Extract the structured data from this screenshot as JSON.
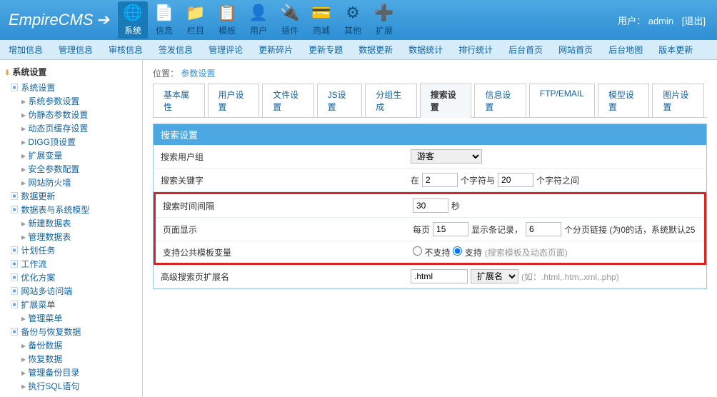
{
  "header": {
    "logo": "EmpireCMS",
    "user_label": "用户：",
    "user_name": "admin",
    "logout": "[退出]",
    "icons": [
      {
        "label": "系统",
        "glyph": "🌐",
        "active": true
      },
      {
        "label": "信息",
        "glyph": "📄"
      },
      {
        "label": "栏目",
        "glyph": "📁"
      },
      {
        "label": "模板",
        "glyph": "📋"
      },
      {
        "label": "用户",
        "glyph": "👤"
      },
      {
        "label": "插件",
        "glyph": "🔌"
      },
      {
        "label": "商城",
        "glyph": "💳"
      },
      {
        "label": "其他",
        "glyph": "⚙"
      },
      {
        "label": "扩展",
        "glyph": "➕"
      }
    ]
  },
  "menubar": [
    "增加信息",
    "管理信息",
    "审核信息",
    "签发信息",
    "管理评论",
    "更新碎片",
    "更新专题",
    "数据更新",
    "数据统计",
    "排行统计",
    "后台首页",
    "网站首页",
    "后台地图",
    "版本更新"
  ],
  "sidebar": {
    "title": "系统设置",
    "tree": [
      {
        "t": "folder",
        "label": "系统设置",
        "children": [
          {
            "t": "leaf",
            "label": "系统参数设置"
          },
          {
            "t": "leaf",
            "label": "伪静态参数设置"
          },
          {
            "t": "leaf",
            "label": "动态页缓存设置"
          },
          {
            "t": "leaf",
            "label": "DIGG顶设置"
          },
          {
            "t": "leaf",
            "label": "扩展变量"
          },
          {
            "t": "leaf",
            "label": "安全参数配置"
          },
          {
            "t": "leaf",
            "label": "网站防火墙"
          }
        ]
      },
      {
        "t": "folder",
        "label": "数据更新"
      },
      {
        "t": "folder",
        "label": "数据表与系统模型",
        "children": [
          {
            "t": "leaf",
            "label": "新建数据表"
          },
          {
            "t": "leaf",
            "label": "管理数据表"
          }
        ]
      },
      {
        "t": "folder",
        "label": "计划任务"
      },
      {
        "t": "folder",
        "label": "工作流"
      },
      {
        "t": "folder",
        "label": "优化方案"
      },
      {
        "t": "folder",
        "label": "网站多访问端"
      },
      {
        "t": "folder",
        "label": "扩展菜单",
        "children": [
          {
            "t": "leaf",
            "label": "管理菜单"
          }
        ]
      },
      {
        "t": "folder",
        "label": "备份与恢复数据",
        "children": [
          {
            "t": "leaf",
            "label": "备份数据"
          },
          {
            "t": "leaf",
            "label": "恢复数据"
          },
          {
            "t": "leaf",
            "label": "管理备份目录"
          },
          {
            "t": "leaf",
            "label": "执行SQL语句"
          }
        ]
      }
    ]
  },
  "breadcrumb": {
    "prefix": "位置：",
    "link": "参数设置"
  },
  "tabs": [
    "基本属性",
    "用户设置",
    "文件设置",
    "JS设置",
    "分组生成",
    "搜索设置",
    "信息设置",
    "FTP/EMAIL",
    "模型设置",
    "图片设置"
  ],
  "active_tab": 5,
  "panel": {
    "title": "搜索设置",
    "rows": {
      "usergroup": {
        "label": "搜索用户组",
        "value": "游客"
      },
      "keyword": {
        "label": "搜索关键字",
        "pre": "在",
        "v1": "2",
        "mid": "个字符与",
        "v2": "20",
        "post": "个字符之间"
      },
      "interval": {
        "label": "搜索时间间隔",
        "v": "30",
        "unit": "秒"
      },
      "page": {
        "label": "页面显示",
        "pre": "每页",
        "v1": "15",
        "mid": "显示条记录，",
        "v2": "6",
        "post": "个分页链接 (为0的话，系统默认25"
      },
      "tpl": {
        "label": "支持公共模板变量",
        "opt0": "不支持",
        "opt1": "支持",
        "hint": "(搜索模板及动态页面)"
      },
      "ext": {
        "label": "高级搜索页扩展名",
        "v": ".html",
        "sel": "扩展名",
        "hint": "(如：.html,.htm,.xml,.php)"
      }
    }
  }
}
